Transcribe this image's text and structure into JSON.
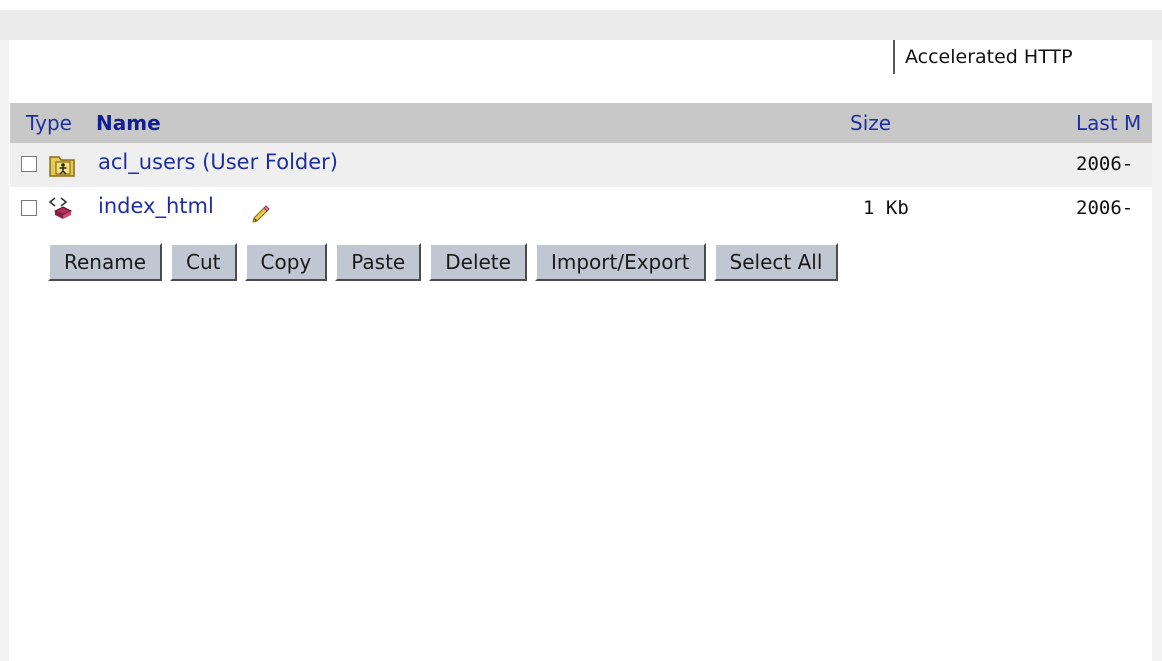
{
  "type_select": {
    "value": "Accelerated HTTP"
  },
  "table": {
    "headers": {
      "type": "Type",
      "name": "Name",
      "size": "Size",
      "modified": "Last M"
    },
    "rows": [
      {
        "name": "acl_users (User Folder)",
        "size": "",
        "modified": "2006-",
        "icon": "user-folder-icon"
      },
      {
        "name": "index_html",
        "size": "1 Kb",
        "modified": "2006-",
        "icon": "dtml-document-icon",
        "lock_icon": "pencil-icon"
      }
    ]
  },
  "toolbar": {
    "rename": "Rename",
    "cut": "Cut",
    "copy": "Copy",
    "paste": "Paste",
    "delete": "Delete",
    "import_export": "Import/Export",
    "select_all": "Select All"
  },
  "colors": {
    "link": "#1f2fa0",
    "header_bg": "#c8c8c8",
    "button_bg": "#c0c6d2"
  }
}
